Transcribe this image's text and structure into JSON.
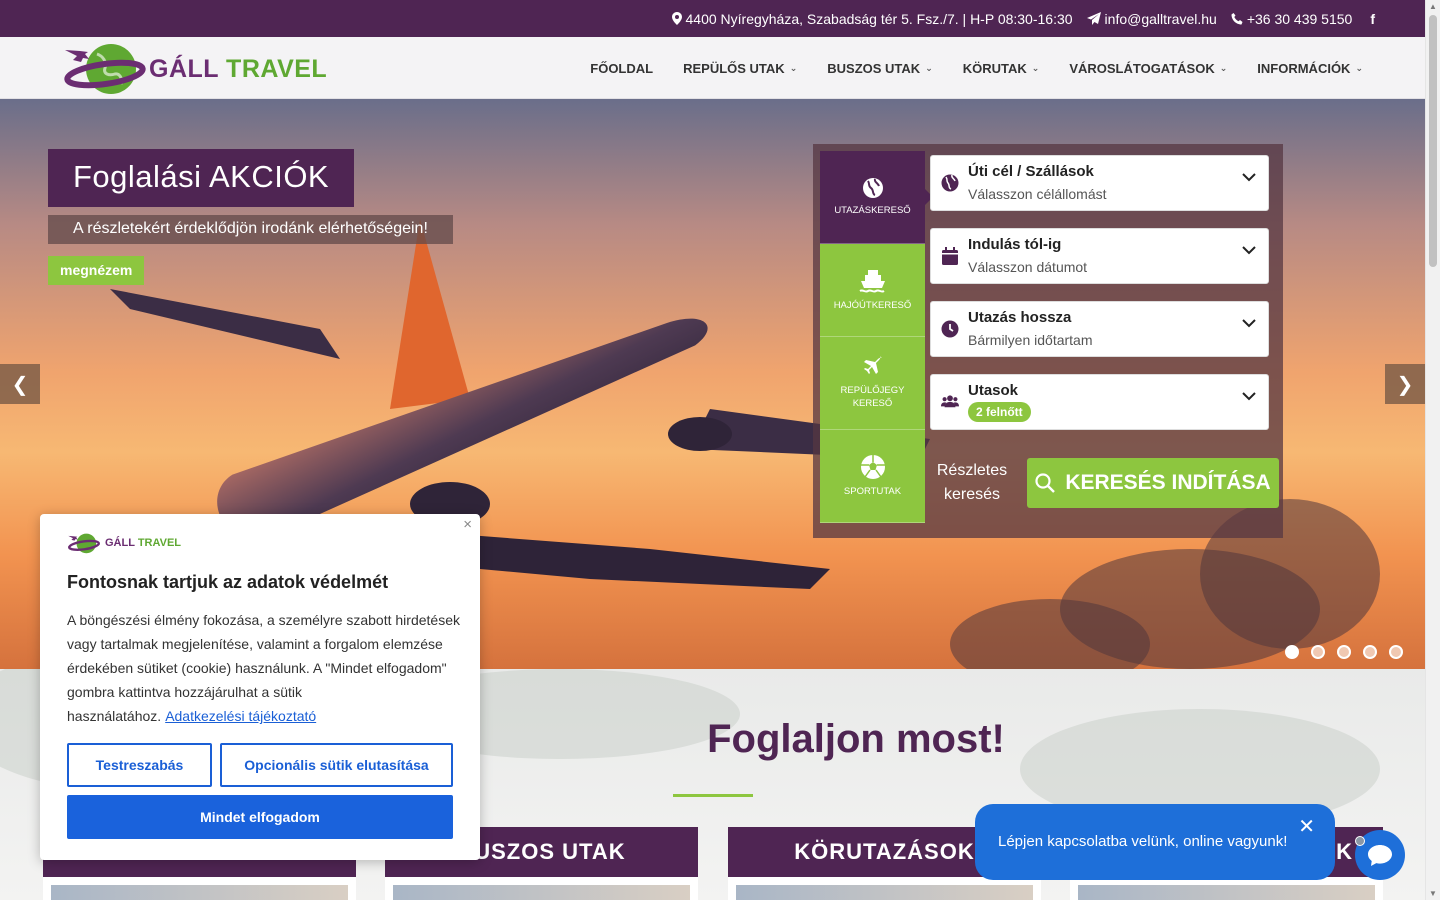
{
  "topbar": {
    "address": "4400 Nyíregyháza, Szabadság tér 5. Fsz./7. | H-P 08:30-16:30",
    "email": "info@galltravel.hu",
    "phone": "+36 30 439 5150",
    "facebook": "f"
  },
  "header": {
    "logo_main": "GÁLL",
    "logo_accent": "TRAVEL",
    "nav": [
      {
        "label": "FŐOLDAL",
        "chevron": ""
      },
      {
        "label": "REPÜLŐS UTAK",
        "chevron": "⌄"
      },
      {
        "label": "BUSZOS UTAK",
        "chevron": "⌄"
      },
      {
        "label": "KÖRUTAK",
        "chevron": "⌄"
      },
      {
        "label": "VÁROSLÁTOGATÁSOK",
        "chevron": "⌄"
      },
      {
        "label": "INFORMÁCIÓK",
        "chevron": "⌄"
      }
    ]
  },
  "hero": {
    "title": "Foglalási AKCIÓK",
    "subtitle": "A részletekért érdeklődjön irodánk elérhetőségein!",
    "button": "megnézem",
    "prev": "❮",
    "next": "❯",
    "slides": 5,
    "active_slide": 0
  },
  "search": {
    "tabs": [
      {
        "label": "UTAZÁSKERESŐ",
        "icon": "globe-icon"
      },
      {
        "label": "HAJÓÚTKERESŐ",
        "icon": "ship-icon"
      },
      {
        "label": "REPÜLŐJEGY KERESŐ",
        "icon": "plane-icon"
      },
      {
        "label": "SPORTUTAK",
        "icon": "soccer-ball-icon"
      }
    ],
    "fields": [
      {
        "label": "Úti cél / Szállások",
        "value": "Válasszon célállomást",
        "icon": "globe-icon"
      },
      {
        "label": "Indulás tól-ig",
        "value": "Válasszon dátumot",
        "icon": "calendar-icon"
      },
      {
        "label": "Utazás hossza",
        "value": "Bármilyen időtartam",
        "icon": "clock-icon"
      },
      {
        "label": "Utasok",
        "value": "2 felnőtt",
        "icon": "users-icon"
      }
    ],
    "detail_link": "Részletes keresés",
    "submit": "KERESÉS INDÍTÁSA"
  },
  "section": {
    "title": "Foglaljon most!",
    "categories": [
      "",
      "BUSZOS UTAK",
      "KÖRUTAZÁSOK",
      "K"
    ]
  },
  "cookie": {
    "close": "×",
    "logo_main": "GÁLL",
    "logo_accent": "TRAVEL",
    "title": "Fontosnak tartjuk az adatok védelmét",
    "text": "A böngészési élmény fokozása, a személyre szabott hirdetések vagy tartalmak megjelenítése, valamint a forgalom elemzése érdekében sütiket (cookie) használunk. A \"Mindet elfogadom\" gombra kattintva hozzájárulhat a sütik használatához.",
    "link": "Adatkezelési tájékoztató",
    "customize": "Testreszabás",
    "reject": "Opcionális sütik elutasítása",
    "accept": "Mindet elfogadom"
  },
  "chat": {
    "message": "Lépjen kapcsolatba velünk, online vagyunk!",
    "close": "✕"
  },
  "colors": {
    "brand_purple": "#4f2553",
    "brand_green": "#8dc63f",
    "cookie_blue": "#1a62dc",
    "chat_blue": "#1e6fd9"
  }
}
